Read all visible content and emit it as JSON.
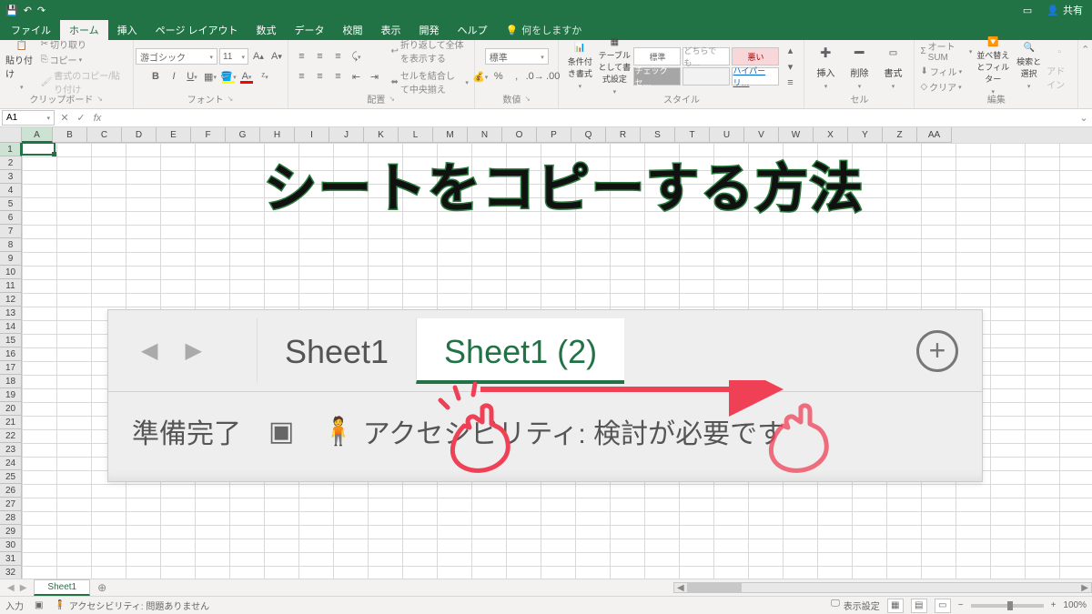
{
  "title_bar": {
    "share": "共有"
  },
  "tabs": {
    "file": "ファイル",
    "home": "ホーム",
    "insert": "挿入",
    "page_layout": "ページ レイアウト",
    "formulas": "数式",
    "data": "データ",
    "review": "校閲",
    "view": "表示",
    "developer": "開発",
    "help": "ヘルプ",
    "tell_me": "何をしますか"
  },
  "ribbon": {
    "clipboard": {
      "paste": "貼り付け",
      "cut": "切り取り",
      "copy": "コピー",
      "format_painter": "書式のコピー/貼り付け",
      "label": "クリップボード"
    },
    "font": {
      "name": "游ゴシック",
      "size": "11",
      "label": "フォント"
    },
    "align": {
      "wrap": "折り返して全体を表示する",
      "merge": "セルを結合して中央揃え",
      "label": "配置"
    },
    "number": {
      "format": "標準",
      "label": "数値"
    },
    "styles": {
      "cond": "条件付き書式",
      "table": "テーブルとして書式設定",
      "s1": "標準",
      "s2": "どちらでも…",
      "s3": "悪い",
      "s4": "チェック セ…",
      "s5": "",
      "s6": "ハイパーリ…",
      "label": "スタイル"
    },
    "cells": {
      "insert": "挿入",
      "delete": "削除",
      "format": "書式",
      "label": "セル"
    },
    "editing": {
      "autosum": "オート SUM",
      "fill": "フィル",
      "clear": "クリア",
      "sort": "並べ替えとフィルター",
      "find": "検索と選択",
      "addin": "アドイン",
      "label": "編集"
    }
  },
  "formula_bar": {
    "name_box": "A1"
  },
  "columns": [
    "A",
    "B",
    "C",
    "D",
    "E",
    "F",
    "G",
    "H",
    "I",
    "J",
    "K",
    "L",
    "M",
    "N",
    "O",
    "P",
    "Q",
    "R",
    "S",
    "T",
    "U",
    "V",
    "W",
    "X",
    "Y",
    "Z",
    "AA"
  ],
  "rows_count": 32,
  "overlay": {
    "title": "シートをコピーする方法",
    "inset": {
      "tab1": "Sheet1",
      "tab2": "Sheet1 (2)",
      "status_ready": "準備完了",
      "accessibility": "アクセシビリティ: 検討が必要です"
    }
  },
  "sheet_tabs": {
    "sheet1": "Sheet1"
  },
  "status": {
    "mode": "入力",
    "accessibility": "アクセシビリティ: 問題ありません",
    "display_settings": "表示設定",
    "zoom": "100%"
  }
}
